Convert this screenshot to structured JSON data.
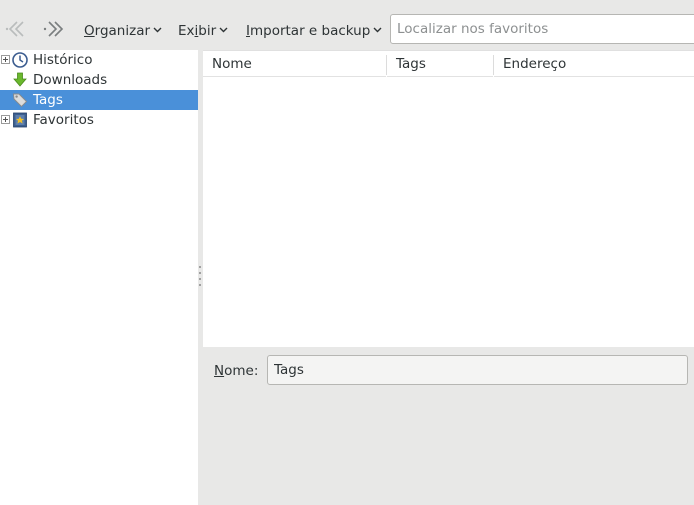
{
  "toolbar": {
    "menus": [
      {
        "pre": "",
        "ul": "O",
        "post": "rganizar"
      },
      {
        "pre": "Ex",
        "ul": "i",
        "post": "bir"
      },
      {
        "pre": "",
        "ul": "I",
        "post": "mportar e backup"
      }
    ],
    "search_placeholder": "Localizar nos favoritos"
  },
  "sidebar": {
    "items": [
      {
        "label": "Histórico",
        "icon": "clock-icon",
        "expandable": true,
        "selected": false
      },
      {
        "label": "Downloads",
        "icon": "download-arrow-icon",
        "expandable": false,
        "selected": false
      },
      {
        "label": "Tags",
        "icon": "tag-icon",
        "expandable": false,
        "selected": true
      },
      {
        "label": "Favoritos",
        "icon": "bookmarks-folder-icon",
        "expandable": true,
        "selected": false
      }
    ]
  },
  "table": {
    "columns": [
      "Nome",
      "Tags",
      "Endereço"
    ],
    "rows": []
  },
  "details": {
    "name_label_ul": "N",
    "name_label_rest": "ome:",
    "name_value": "Tags"
  },
  "colors": {
    "selection": "#4a90d9",
    "window_bg": "#e8e8e7"
  }
}
